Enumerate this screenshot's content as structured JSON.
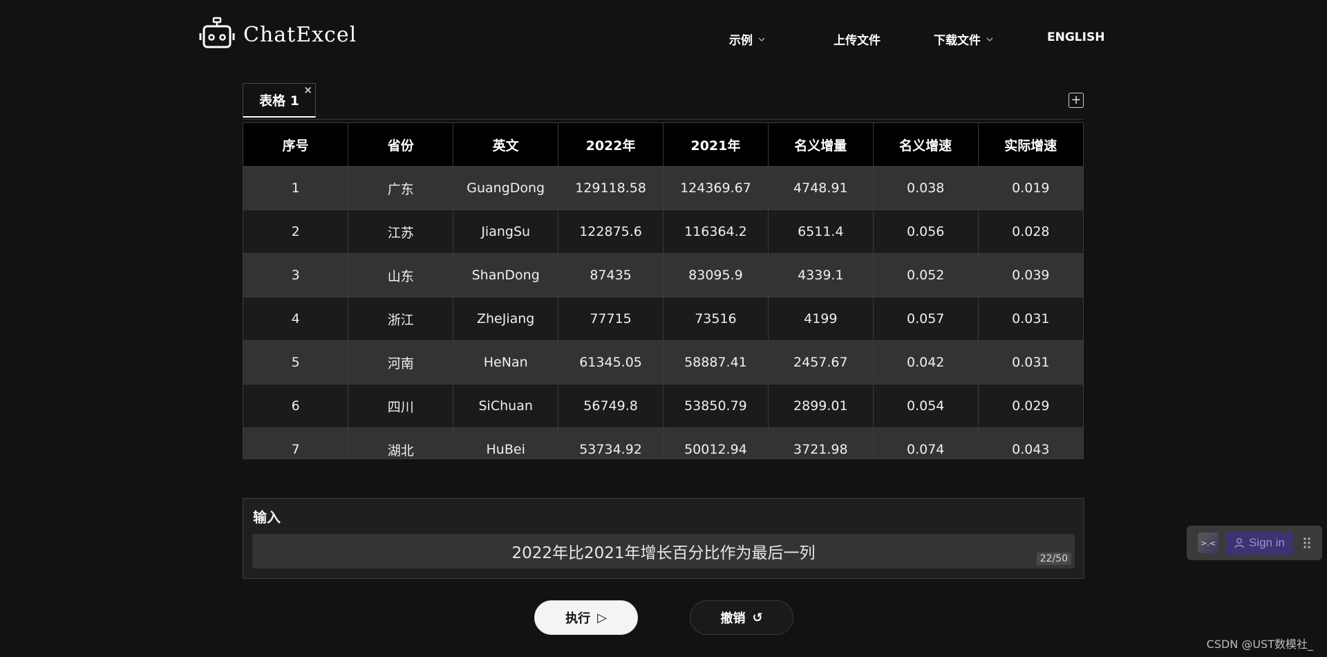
{
  "app": {
    "logo_text": "ChatExcel"
  },
  "nav": {
    "examples": "示例",
    "upload": "上传文件",
    "download": "下载文件",
    "language": "ENGLISH"
  },
  "tabs": [
    {
      "label": "表格 1",
      "close": "×"
    }
  ],
  "tab_add": "+",
  "table": {
    "headers": [
      "序号",
      "省份",
      "英文",
      "2022年",
      "2021年",
      "名义增量",
      "名义增速",
      "实际增速"
    ],
    "rows": [
      [
        "1",
        "广东",
        "GuangDong",
        "129118.58",
        "124369.67",
        "4748.91",
        "0.038",
        "0.019"
      ],
      [
        "2",
        "江苏",
        "JiangSu",
        "122875.6",
        "116364.2",
        "6511.4",
        "0.056",
        "0.028"
      ],
      [
        "3",
        "山东",
        "ShanDong",
        "87435",
        "83095.9",
        "4339.1",
        "0.052",
        "0.039"
      ],
      [
        "4",
        "浙江",
        "ZheJiang",
        "77715",
        "73516",
        "4199",
        "0.057",
        "0.031"
      ],
      [
        "5",
        "河南",
        "HeNan",
        "61345.05",
        "58887.41",
        "2457.67",
        "0.042",
        "0.031"
      ],
      [
        "6",
        "四川",
        "SiChuan",
        "56749.8",
        "53850.79",
        "2899.01",
        "0.054",
        "0.029"
      ],
      [
        "7",
        "湖北",
        "HuBei",
        "53734.92",
        "50012.94",
        "3721.98",
        "0.074",
        "0.043"
      ]
    ]
  },
  "input": {
    "label": "输入",
    "value": "2022年比2021年增长百分比作为最后一列",
    "counter": "22/50"
  },
  "buttons": {
    "run": "执行",
    "run_icon": "▷",
    "undo": "撤销",
    "undo_icon": "↺"
  },
  "widget": {
    "face": ">.<",
    "signin": "Sign in"
  },
  "watermark": "CSDN @UST数模社_"
}
